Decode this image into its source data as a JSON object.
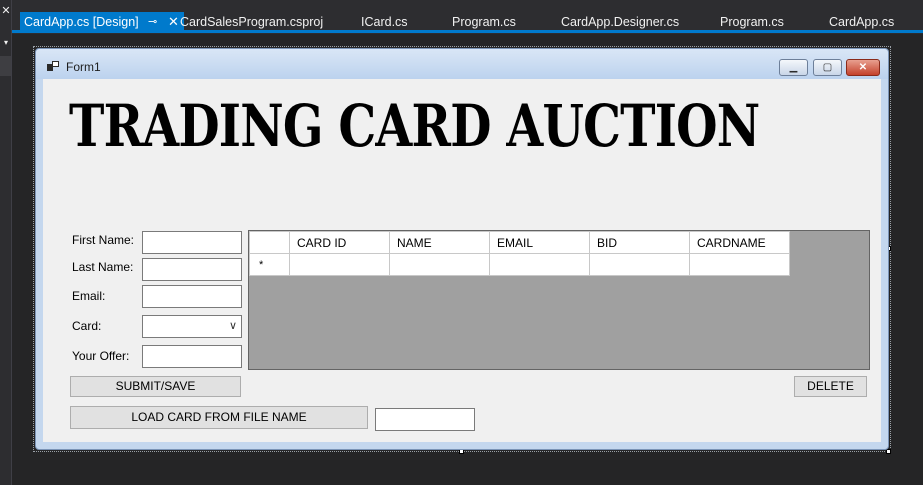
{
  "tabs": [
    {
      "label": "CardApp.cs [Design]",
      "active": true
    },
    {
      "label": "CardSalesProgram.csproj"
    },
    {
      "label": "ICard.cs"
    },
    {
      "label": "Program.cs"
    },
    {
      "label": "CardApp.Designer.cs"
    },
    {
      "label": "Program.cs"
    },
    {
      "label": "CardApp.cs"
    }
  ],
  "icons": {
    "pin": "⊸",
    "close": "✕",
    "gutter_close": "✕",
    "gutter_arrow": "▾",
    "minimize": "▁",
    "maximize": "▢",
    "window_close": "✕",
    "combo_chevron": "∨",
    "new_row": "*"
  },
  "form": {
    "title": "Form1",
    "headline": "TRADING CARD AUCTION",
    "labels": {
      "first_name": "First Name:",
      "last_name": "Last Name:",
      "email": "Email:",
      "card": "Card:",
      "offer": "Your Offer:"
    },
    "buttons": {
      "submit": "SUBMIT/SAVE",
      "delete": "DELETE",
      "load": "LOAD CARD FROM FILE NAME"
    },
    "grid": {
      "columns": [
        "CARD ID",
        "NAME",
        "EMAIL",
        "BID",
        "CARDNAME"
      ]
    }
  },
  "colors": {
    "accent": "#007acc",
    "ide_background": "#1e1e1e",
    "form_client": "#f0f0f0",
    "grid_background": "#a0a0a0"
  }
}
